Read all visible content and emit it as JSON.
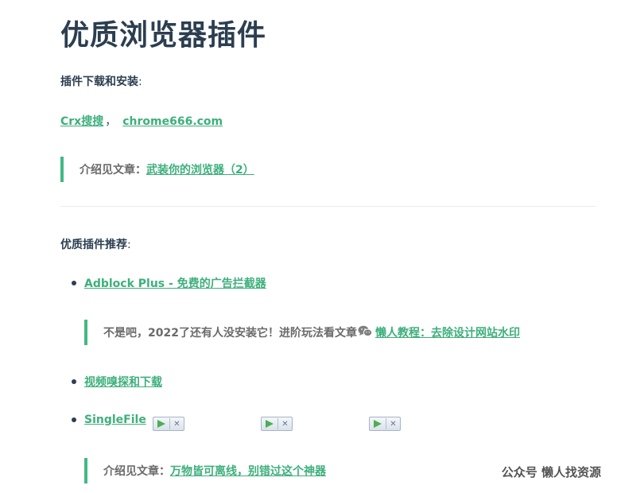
{
  "title": "优质浏览器插件",
  "download_section": {
    "label": "插件下载和安装",
    "colon": ":",
    "links": [
      {
        "text": "Crx搜搜"
      },
      {
        "text": "chrome666.com"
      }
    ],
    "separator": "，",
    "quote_prefix": "介绍见文章：",
    "quote_link": "武装你的浏览器（2）"
  },
  "recommend_section": {
    "label": "优质插件推荐",
    "colon": ":",
    "items": [
      {
        "link": "Adblock Plus - 免费的广告拦截器",
        "quote_text": "不是吧，2022了还有人没安装它！进阶玩法看文章",
        "quote_icon": "wechat-icon",
        "quote_link": "懒人教程：去除设计网站水印"
      },
      {
        "link": "视频嗅探和下载"
      },
      {
        "link": "SingleFile",
        "media_buttons": [
          "media-player-button",
          "media-player-button",
          "media-player-button"
        ],
        "quote_prefix": "介绍见文章：",
        "quote_link": "万物皆可离线，别错过这个神器"
      }
    ]
  },
  "watermark": "公众号 懒人找资源",
  "colors": {
    "accent": "#3eaf7c",
    "quote_border": "#42b983",
    "heading": "#2c3e50"
  }
}
